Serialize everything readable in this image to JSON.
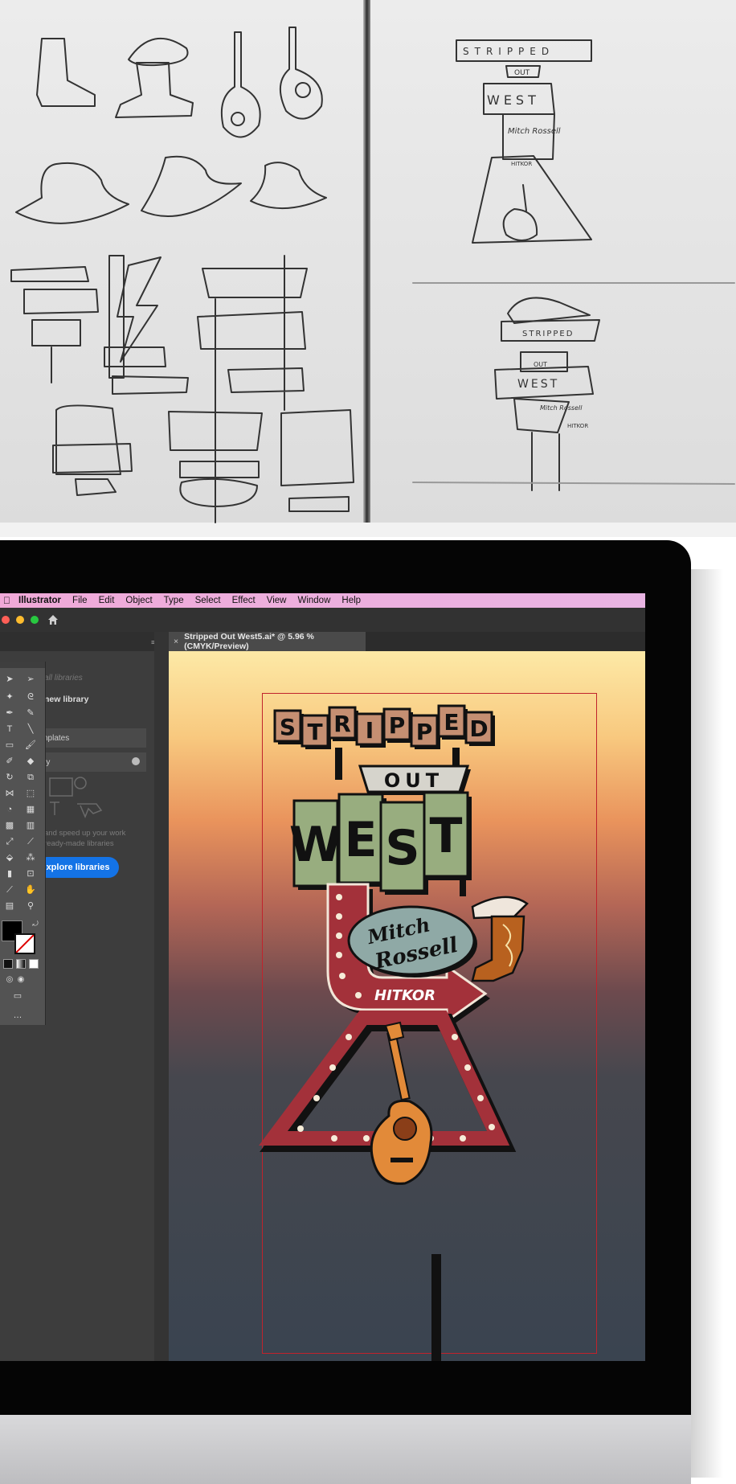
{
  "sketch": {
    "left_sign": {
      "top_word": "STRIPPED",
      "middle_word": "OUT",
      "bottom_word": "WEST",
      "name": "Mitch Rossell",
      "arrow_text": "HITKOR"
    },
    "right_sign": {
      "top_word": "STRIPPED",
      "middle_word": "OUT",
      "bottom_word": "WEST",
      "name": "Mitch Rossell",
      "arrow_text": "HITKOR"
    }
  },
  "menubar": {
    "app_name": "Illustrator",
    "items": [
      "File",
      "Edit",
      "Object",
      "Type",
      "Select",
      "Effect",
      "View",
      "Window",
      "Help"
    ]
  },
  "document_tab": {
    "close_glyph": "×",
    "title": "Stripped Out West5.ai* @ 5.96 % (CMYK/Preview)"
  },
  "libraries_panel": {
    "search_placeholder": "all libraries",
    "new_library_label": "new library",
    "rows": [
      "nplates",
      "ry"
    ],
    "description": "and speed up your work ready-made libraries",
    "explore_button": "xplore libraries"
  },
  "artwork": {
    "letters_top": [
      "S",
      "T",
      "R",
      "I",
      "P",
      "P",
      "E",
      "D"
    ],
    "middle_word": "OUT",
    "letters_bottom": [
      "W",
      "E",
      "S",
      "T"
    ],
    "name_line1": "Mitch",
    "name_line2": "Rossell",
    "arrow_label": "HITKOR"
  },
  "colors": {
    "menubar": "#eeaadd",
    "accent_blue": "#1473e6",
    "sign_red": "#a3313a",
    "sign_green": "#98ad7f",
    "sign_tan": "#c58f72",
    "oval_teal": "#8fa9a6",
    "guitar_orange": "#e28a39",
    "boot_brown": "#b8611f",
    "artboard_border": "#c0232c"
  }
}
